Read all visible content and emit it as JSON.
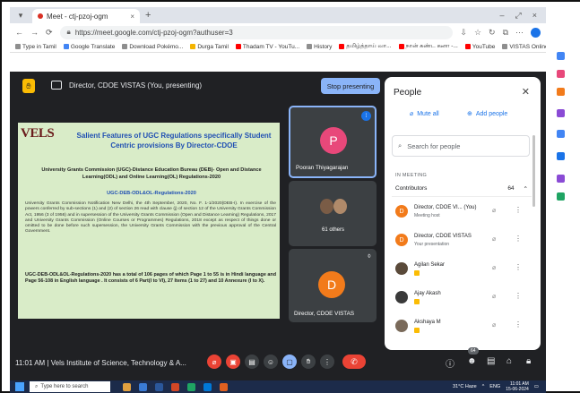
{
  "browser": {
    "tab_title": "Meet - ctj-pzoj-ogm",
    "tab_close": "×",
    "new_tab": "+",
    "url": "https://meet.google.com/ctj-pzoj-ogm?authuser=3",
    "win_min": "–",
    "win_max": "⤢",
    "win_close": "×",
    "bookmarks": [
      {
        "label": "Type in Tamil",
        "color": "#8e8e8e"
      },
      {
        "label": "Google Translate",
        "color": "#4285f4"
      },
      {
        "label": "Download Pokémo...",
        "color": "#8e8e8e"
      },
      {
        "label": "Durga Tamil",
        "color": "#f4b400"
      },
      {
        "label": "Thadam TV - YouTu...",
        "color": "#ff0000"
      },
      {
        "label": "History",
        "color": "#8e8e8e"
      },
      {
        "label": "தமிழ்த்தாய் வா...",
        "color": "#ff0000"
      },
      {
        "label": "நான் கண்ட கனா -...",
        "color": "#ff0000"
      },
      {
        "label": "YouTube",
        "color": "#ff0000"
      },
      {
        "label": "VISTAS Online Exam",
        "color": "#8e8e8e"
      }
    ]
  },
  "meet": {
    "presenting_label": "Director, CDOE VISTAS (You, presenting)",
    "stop_button": "Stop presenting",
    "time": "11:01 AM",
    "meeting_title": "Vels Institute of Science, Technology & A...",
    "participants_badge": "64"
  },
  "slide": {
    "logo": "VELS",
    "title": "Salient Features of UGC Regulations specifically Student Centric provisions By Director-CDOE",
    "subtitle": "University Grants Commission (UGC)-Distance Education Bureau (DEB)- Open and Distance Learning(ODL) and Online Learning(OL) Regulations-2020",
    "ref": "UGC-DEB-ODL&OL-Regulations-2020",
    "body": "University Grants Commission Notification New Delhi, the 4th September, 2020, No. F. 1-1/2020(DEB-I). In exercise of the powers conferred by sub-sections (1) and (2) of section 26 read with clause (j) of section 12 of the University Grants Commission Act, 1956 (3 of 1956) and in supersession of the University Grants Commission (Open and Distance Learning) Regulations, 2017 and University Grants Commission (Online Courses or Programmes) Regulations, 2018 except as respect of things done or omitted to be done before such supersession, the University Grants Commission with the previous approval of the Central Government.",
    "body2": "UGC-DEB-ODL&OL-Regulations-2020 has a total of 106 pages of which Page 1 to 55 is in Hindi language and Page 56-108 in English language . It consists of 6 Part(I to VI), 27 Items (1 to 27) and 10 Annexure (I to X)."
  },
  "tiles": [
    {
      "name": "Pooran Thiyagarajan",
      "initial": "P",
      "color": "#e8487a"
    },
    {
      "name": "61 others"
    },
    {
      "name": "Director, CDOE VISTAS",
      "initial": "D",
      "color": "#f27b1b"
    }
  ],
  "people": {
    "title": "People",
    "mute_all": "Mute all",
    "add_people": "Add people",
    "search_placeholder": "Search for people",
    "section": "IN MEETING",
    "contributors_label": "Contributors",
    "contributors_count": "64",
    "rows": [
      {
        "initial": "D",
        "name": "Director, CDOE VI...  (You)",
        "sub": "Meeting host",
        "color": "#f27b1b"
      },
      {
        "initial": "D",
        "name": "Director, CDOE VISTAS",
        "sub": "Your presentation",
        "color": "#f27b1b"
      },
      {
        "initial": "",
        "name": "Agilan Sekar",
        "sub": "",
        "color": "#5a4a3a"
      },
      {
        "initial": "",
        "name": "Ajay Akash",
        "sub": "",
        "color": "#3a3a3a"
      },
      {
        "initial": "",
        "name": "Akshaya M",
        "sub": "",
        "color": "#7a6a5a"
      }
    ]
  },
  "taskbar": {
    "search": "Type here to search",
    "weather": "31°C Haze",
    "lang": "ENG",
    "clock_time": "11:01 AM",
    "clock_date": "15-06-2024"
  },
  "colors": {
    "meet_bg": "#202124",
    "accent": "#8ab4f8",
    "end_call": "#ea4335",
    "slide_bg": "#d9ecc8"
  }
}
